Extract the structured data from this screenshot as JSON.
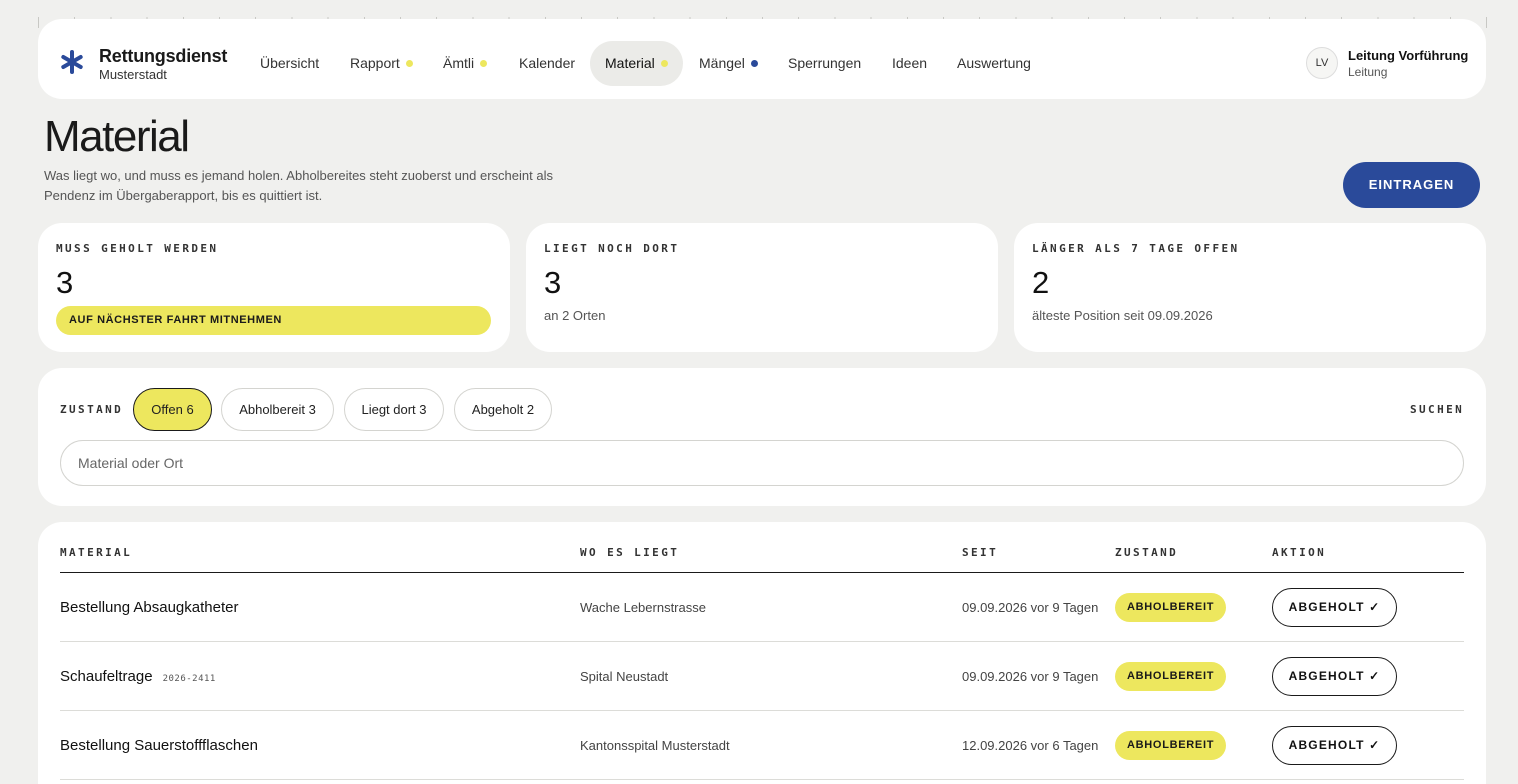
{
  "colors": {
    "background": "#f0f0ee",
    "accent_yellow": "#ede75e",
    "primary_blue": "#2a4a9a",
    "nav_dot_yellow": "#ede75e",
    "nav_dot_blue": "#2a4a9a"
  },
  "brand": {
    "icon": "asterisk-icon",
    "name": "Rettungsdienst",
    "sub": "Musterstadt"
  },
  "nav": {
    "items": [
      {
        "label": "Übersicht",
        "dot": ""
      },
      {
        "label": "Rapport",
        "dot": "yellow"
      },
      {
        "label": "Ämtli",
        "dot": "yellow"
      },
      {
        "label": "Kalender",
        "dot": ""
      },
      {
        "label": "Material",
        "dot": "yellow",
        "active": true
      },
      {
        "label": "Mängel",
        "dot": "blue"
      },
      {
        "label": "Sperrungen",
        "dot": ""
      },
      {
        "label": "Ideen",
        "dot": ""
      },
      {
        "label": "Auswertung",
        "dot": ""
      }
    ]
  },
  "user": {
    "initials": "LV",
    "name": "Leitung Vorführung",
    "role": "Leitung"
  },
  "page": {
    "title": "Material",
    "description": "Was liegt wo, und muss es jemand holen. Abholbereites steht zuoberst und erscheint als Pendenz im Übergaberapport, bis es quittiert ist.",
    "primary_action": "EINTRAGEN"
  },
  "stats": [
    {
      "label": "MUSS GEHOLT WERDEN",
      "value": "3",
      "pill": "AUF NÄCHSTER FAHRT MITNEHMEN"
    },
    {
      "label": "LIEGT NOCH DORT",
      "value": "3",
      "sub": "an 2 Orten"
    },
    {
      "label": "LÄNGER ALS 7 TAGE OFFEN",
      "value": "2",
      "sub": "älteste Position seit 09.09.2026"
    }
  ],
  "filter": {
    "label": "ZUSTAND",
    "chips": [
      {
        "label": "Offen 6",
        "active": true
      },
      {
        "label": "Abholbereit 3",
        "active": false
      },
      {
        "label": "Liegt dort 3",
        "active": false
      },
      {
        "label": "Abgeholt 2",
        "active": false
      }
    ],
    "search_label": "SUCHEN",
    "search_placeholder": "Material oder Ort"
  },
  "table": {
    "headers": {
      "material": "MATERIAL",
      "location": "WO ES LIEGT",
      "since": "SEIT",
      "state": "ZUSTAND",
      "action": "AKTION"
    },
    "rows": [
      {
        "material": "Bestellung Absaugkatheter",
        "ref": "",
        "location": "Wache Lebernstrasse",
        "since": "09.09.2026 vor 9 Tagen",
        "state": "ABHOLBEREIT",
        "action": "ABGEHOLT ✓"
      },
      {
        "material": "Schaufeltrage",
        "ref": "2026-2411",
        "location": "Spital Neustadt",
        "since": "09.09.2026 vor 9 Tagen",
        "state": "ABHOLBEREIT",
        "action": "ABGEHOLT ✓"
      },
      {
        "material": "Bestellung Sauerstoffflaschen",
        "ref": "",
        "location": "Kantonsspital Musterstadt",
        "since": "12.09.2026 vor 6 Tagen",
        "state": "ABHOLBEREIT",
        "action": "ABGEHOLT ✓"
      }
    ]
  }
}
